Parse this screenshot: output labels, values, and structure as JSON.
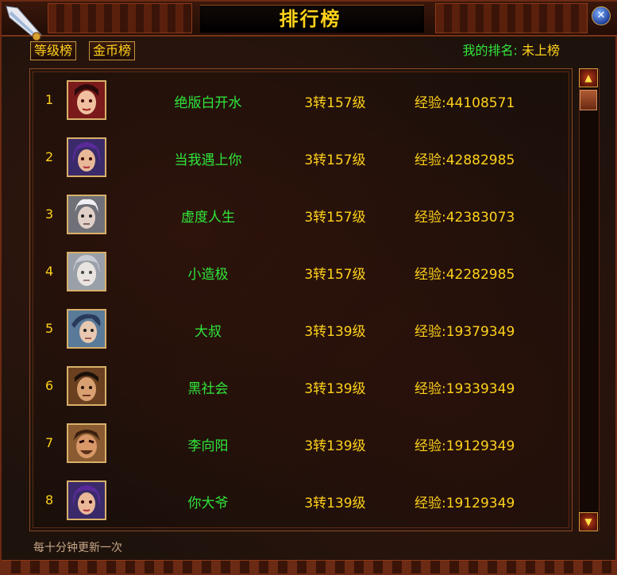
{
  "window": {
    "title": "排行榜",
    "close_icon": "close-icon"
  },
  "tabs": [
    {
      "label": "等级榜"
    },
    {
      "label": "金币榜"
    }
  ],
  "my_rank": {
    "label": "我的排名:",
    "value": "未上榜"
  },
  "rows": [
    {
      "rank": "1",
      "name": "绝版白开水",
      "level": "3转157级",
      "exp": "经验:44108571"
    },
    {
      "rank": "2",
      "name": "当我遇上你",
      "level": "3转157级",
      "exp": "经验:42882985"
    },
    {
      "rank": "3",
      "name": "虚度人生",
      "level": "3转157级",
      "exp": "经验:42383073"
    },
    {
      "rank": "4",
      "name": "小造极",
      "level": "3转157级",
      "exp": "经验:42282985"
    },
    {
      "rank": "5",
      "name": "大叔",
      "level": "3转139级",
      "exp": "经验:19379349"
    },
    {
      "rank": "6",
      "name": "黑社会",
      "level": "3转139级",
      "exp": "经验:19339349"
    },
    {
      "rank": "7",
      "name": "李向阳",
      "level": "3转139级",
      "exp": "经验:19129349"
    },
    {
      "rank": "8",
      "name": "你大爷",
      "level": "3转139级",
      "exp": "经验:19129349"
    }
  ],
  "footer": {
    "note": "每十分钟更新一次"
  },
  "colors": {
    "name_green": "#2fe63a",
    "gold": "#ffd21a",
    "frame": "#8b4a22"
  }
}
